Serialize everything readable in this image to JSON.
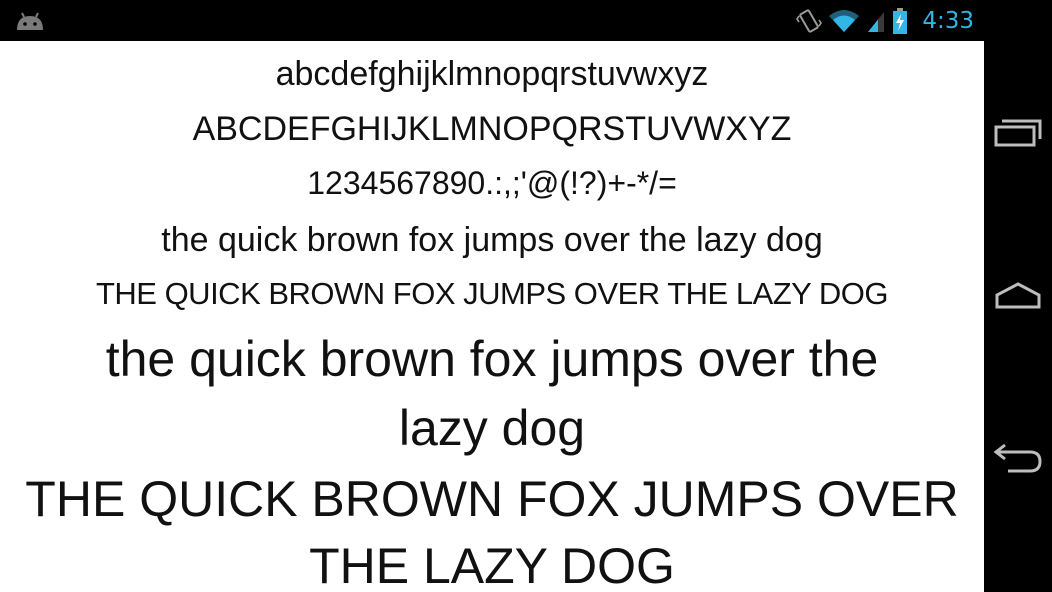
{
  "status_bar": {
    "time": "4:33",
    "icons": [
      "android-icon",
      "vibrate-icon",
      "wifi-icon",
      "signal-icon",
      "battery-charging-icon"
    ],
    "clock_color": "#33b5e5"
  },
  "font_preview": {
    "lowercase": "abcdefghijklmnopqrstuvwxyz",
    "uppercase": "ABCDEFGHIJKLMNOPQRSTUVWXYZ",
    "numbers_symbols": "1234567890.:,;'@(!?)+-*/=",
    "sentence_small_lower": "the quick brown fox jumps over the lazy dog",
    "sentence_small_upper": "THE QUICK BROWN FOX JUMPS OVER THE LAZY DOG",
    "sentence_large_lower_1": "the quick brown fox jumps over the",
    "sentence_large_lower_2": "lazy dog",
    "sentence_large_upper_1": "THE QUICK BROWN FOX JUMPS OVER",
    "sentence_large_upper_2": "THE LAZY DOG"
  },
  "nav_bar": {
    "buttons": [
      "recent-apps-icon",
      "home-icon",
      "back-icon"
    ]
  }
}
